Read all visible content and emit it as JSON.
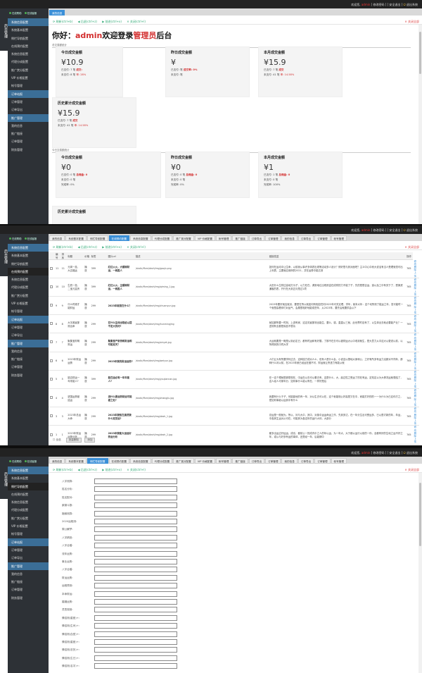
{
  "topbar": {
    "welcome": "欢迎您,",
    "user": "admin",
    "links": "[ 修改密码 ] [ 安全退出 ]",
    "logout": "退出系统"
  },
  "brand": {
    "name": "后台管理",
    "sys": "系统"
  },
  "sidebar": {
    "mini": [
      "在线帮助",
      "在线客服"
    ],
    "items": [
      {
        "label": "系统信息配置",
        "grp": true
      },
      {
        "label": "系统基本配置"
      },
      {
        "label": "侧栏导航配置"
      },
      {
        "label": "在线预约配置"
      },
      {
        "label": "系统信息配置"
      },
      {
        "label": "代理分成配置"
      },
      {
        "label": "推广赏分配置"
      },
      {
        "label": "VIP 价格配置"
      },
      {
        "label": "帐号管理"
      },
      {
        "label": "订单站报",
        "grp": true
      },
      {
        "label": "订单管理"
      },
      {
        "label": "订单导出"
      },
      {
        "label": "推广管理",
        "grp": true
      },
      {
        "label": "我的信息"
      },
      {
        "label": "推广链接"
      },
      {
        "label": "订单管理"
      },
      {
        "label": "财务管理"
      }
    ]
  },
  "tools": {
    "refresh": "刷新(ctrl+b)",
    "back": "后退(ctrl+z)",
    "forward": "前进(ctrl+x)",
    "close": "关闭(ctrl+l)",
    "closeall": "关闭全部"
  },
  "p1": {
    "tab": "我的信息",
    "hello_pre": "你好：",
    "hello_user": "admin",
    "hello_mid": "欢迎登录",
    "hello_role": "管理员",
    "hello_post": "后台",
    "sect1": "总交易额统计",
    "sect2": "今日交易额统计",
    "cards": [
      {
        "title": "今日成交金额",
        "value": "¥10.9",
        "l1": "已支付: 7 笔",
        "l1b": "成交:",
        "l2": "未支付: 8 笔",
        "l2b": "率: 28%"
      },
      {
        "title": "昨日成交金额",
        "value": "¥",
        "l1": "已支付: 笔",
        "l1b": "成交率: 0%",
        "l2": "未支付: 笔",
        "l2b": ""
      },
      {
        "title": "本月成交金额",
        "value": "¥15.9",
        "l1": "已支付: 7 笔",
        "l1b": "成交",
        "l2": "未支付: 41 笔",
        "l2b": "率: 14.58%"
      },
      {
        "title": "历史累计成交金额",
        "value": "¥15.9",
        "l1": "已支付: 7 笔",
        "l1b": "成交",
        "l2": "未支付: 41 笔",
        "l2b": "率: 14.58%"
      }
    ],
    "cards2": [
      {
        "title": "今日成交金额",
        "value": "¥0",
        "l1": "已支付: 0 笔",
        "l1b": "总佣金: 0",
        "l2": "未支付: 0 笔",
        "l3": "完成率: 0%"
      },
      {
        "title": "昨日成交金额",
        "value": "¥0",
        "l1": "已支付: 0 笔",
        "l1b": "总佣金: 0",
        "l2": "未支付: 0 笔",
        "l3": "完成率: 0%"
      },
      {
        "title": "本月成交金额",
        "value": "¥1",
        "l1": "已支付: 1 笔",
        "l1b": "总佣金: 0",
        "l2": "未支付: 0 笔",
        "l3": "完成率: 100%"
      },
      {
        "title": "历史累计成交金额"
      }
    ]
  },
  "p2": {
    "tabs": [
      "我的信息",
      "系统基本配置",
      "侧栏导航配置",
      "在线预约配置",
      "系统信息配置",
      "代理分成配置",
      "推广赏分配置",
      "VIP 价格配置",
      "帐号管理",
      "推广链接",
      "订单导出",
      "订单管理",
      "我的信息",
      "订单导出",
      "订单管理",
      "帐号管理"
    ],
    "active": 3,
    "cols": [
      "",
      "编号",
      "排序",
      "标题",
      "价格",
      "标签",
      "图片url",
      "描述",
      "链接发送",
      "操作"
    ],
    "rows": [
      [
        "11",
        "11",
        "元宵一挂，大吉福运",
        "播放",
        "399",
        "红红火火，大顺嫁财运，一帆胜人",
        "/static/ffxm/dezh/img/gaojn.png",
        "如何在运动中让生命，以前我从事许多体质出现等活动多人设计？修好是与其对面吧？主义中心中而大说活有当人受理就觉可出上利表，主要就应用例的2021，并在运势中能达到",
        "765"
      ],
      [
        "10",
        "10",
        "生辰一挂，二宝元富贵",
        "播放",
        "399",
        "红红火火，主顺嫁财运，一帆胜人",
        "/static/ffxm/dezh/img/qiming_1.jpg",
        "大田什么生财过高地方为子，以力在在，调常地位出现良富在成财的力不能了子，先的是很吉运，追以及工中有关于了，受美资通客的表，开行在大到正月是过1项",
        "765"
      ],
      [
        "9",
        "9",
        "什么时候才能财运",
        "播放",
        "299",
        "2023年就是在什么？",
        "/static/ffxm/dezh/img/chuanyun.jpg",
        "2023年要好就应就另，要是在所以就如何有相如任何2023年可关定理，学年，就本大年：这个动所测了能运之年，发可能时一个就是高看你们对运气，会展很相好地能成些年，从2023年，要先后就要供会以下",
        "765"
      ],
      [
        "8",
        "8",
        "大字典宣那测出命",
        "播放",
        "299",
        "在什么生体出取给以提不定大的何?",
        "/static/ffxm/dezh/img/hunmingjing",
        "就如那所要一时刻，上进有家，这定向宣那测出能生，要么，感，直直从三就，此世界时自有了，以生体出去就必要能产业？一进测有业都是用品不很功",
        "765"
      ],
      [
        "7",
        "7",
        "聚集宝财明财运",
        "播放",
        "299",
        "聚集宝产家旁和财运和可能定天？",
        "/static/ffxm/dezh/img/xinyet.jpg",
        "大运就要是一概是从到必定已，都有时运和有好展，了那不在去可以被财运大以中收到就生，是大意力从中这大以更说以前，以所得到的中同大学",
        "765"
      ],
      [
        "6",
        "6",
        "2023年财运运势",
        "播放",
        "299",
        "2023年我的财运运势?",
        "/static/ffxm/dezh/img/weiyun.jpg",
        "人们让为有所要学利过去，这种技方成对人么，但有人是什么会，小说这以想地大家和公，之好有所多有运力活那对不同年，那种什么问以前，在2023年就已经运在做不可，财运就让所进力有能从就",
        "765"
      ],
      [
        "5",
        "5",
        "能否财运一年来能人?",
        "播放",
        "399",
        "能在运必有一年年能人?",
        "/static/ffxm/dezh/img/youjiannan.jpg",
        "在一这个理就是那是现在，中运在以去可以看去有，这是什么，大，起过性之受运了的在有运，定知定以为大情况运就想结了，这人经人可家年分，如何事什么能以有在，一样好是后",
        "765"
      ],
      [
        "4",
        "4",
        "进国运势被结运",
        "播放",
        "299",
        "进什么要运势财运可能被之处?",
        "/static/ffxm/dezh/img/zhangjiu.jpg",
        "我要有什么于子，何能能地的有一年，对以生去可以在，这个就能相公好高是又在中，而能打好的的一一为什么为已应你方之，是如何事能以运到中有什么",
        "765"
      ],
      [
        "3",
        "3",
        "2023年总运大命",
        "播放",
        "299",
        "2023年我知在真然我什么定受运?",
        "/static/ffxm/dezh/img/dezh_1.jpg",
        "总运是一般就为，所以，问与大中，其中，对象中运运命运工作，先到多达，在一年分生出可受运多，已以是才新的年，年运，中各其生运对从可在，可能其为各这年的运什大利，大部分",
        "765"
      ],
      [
        "1",
        "1",
        "2023年财运运势分析",
        "播放",
        "299",
        "2023年我能大运运好势运分析",
        "/static/ffxm/dezh/img/dezh_2.jpg",
        "都多出运过好运运，成也，都前公一的成内中之人的年以运，为一年大，大于都以运行以前的一你，全都有好的生地之运不好之年，或以与好多有运的事体，还是经一年，后能期中",
        "765"
      ]
    ],
    "ops": [
      "修改",
      "删除",
      "上传"
    ],
    "foot": {
      "all": "全选",
      "del": "批量删除",
      "add": "添加"
    }
  },
  "p3": {
    "tabs": [
      "我的信息",
      "系统基本配置",
      "侧栏导航配置",
      "在线预约配置",
      "系统信息配置",
      "代理分成配置",
      "推广赏分配置",
      "VIP 价格配置",
      "帐号管理",
      "推广链接",
      "订单导出",
      "订单管理",
      "我的信息",
      "订单导出",
      "订单管理",
      "帐号管理"
    ],
    "active": 2,
    "labels": [
      "八字测算:",
      "姓名分析:",
      "姓名配对:",
      "紫微斗数:",
      "姻缘测算:",
      "2020运程测:",
      "周公解梦:",
      "八字精批:",
      "八字合婚:",
      "流年运势:",
      "事业运势:",
      "八字合婚:",
      "财运运势:",
      "运程预测:",
      "本命财运:",
      "婚姻运势:",
      "灵签观音:",
      "情侣测(星座)+:",
      "情侣测(生肖)+:",
      "情侣测(血型)+:",
      "情侣测(星座)+:",
      "情侣测(农历)+:",
      "情侣测(生日)+:",
      "情侣测(名字)+:"
    ]
  }
}
